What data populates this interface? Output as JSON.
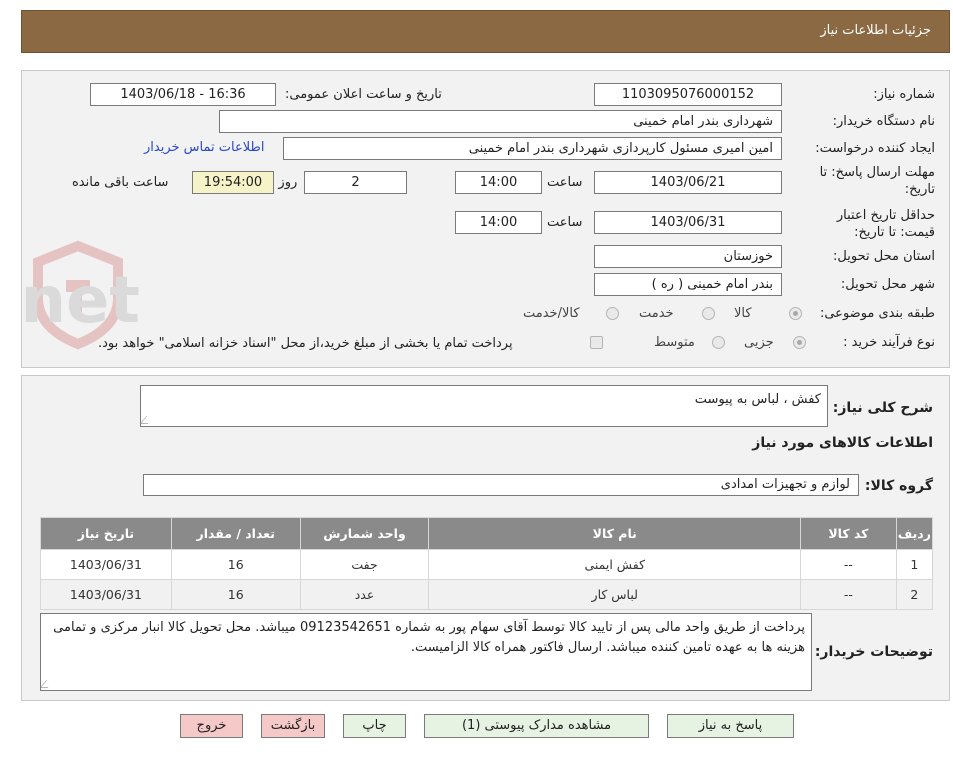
{
  "header": {
    "title": "جزئیات اطلاعات نیاز"
  },
  "form": {
    "need_number_label": "شماره نیاز:",
    "need_number": "1103095076000152",
    "announce_label": "تاریخ و ساعت اعلان عمومی:",
    "announce_value": "1403/06/18 - 16:36",
    "buyer_org_label": "نام دستگاه خریدار:",
    "buyer_org": "شهرداری بندر امام خمینی",
    "creator_label": "ایجاد کننده درخواست:",
    "creator": "امین امیری مسئول کارپردازی شهرداری بندر امام خمینی",
    "contact_link": "اطلاعات تماس خریدار",
    "deadline_label_1": "مهلت ارسال پاسخ: تا",
    "deadline_label_2": "تاریخ:",
    "deadline_date": "1403/06/21",
    "time_label": "ساعت",
    "deadline_time": "14:00",
    "days_value": "2",
    "days_label": "روز و",
    "remaining_time": "19:54:00",
    "remaining_label": "ساعت باقی مانده",
    "validity_label_1": "حداقل تاریخ اعتبار",
    "validity_label_2": "قیمت: تا تاریخ:",
    "validity_date": "1403/06/31",
    "validity_time_label": "ساعت",
    "validity_time": "14:00",
    "province_label": "استان محل تحویل:",
    "province": "خوزستان",
    "city_label": "شهر محل تحویل:",
    "city": "بندر امام خمینی ( ره )",
    "category_label": "طبقه بندی موضوعی:",
    "category_options": [
      "کالا",
      "خدمت",
      "کالا/خدمت"
    ],
    "process_label": "نوع فرآیند خرید :",
    "process_options": [
      "جزیی",
      "متوسط"
    ],
    "payment_note": "پرداخت تمام یا بخشی از مبلغ خرید،از محل \"اسناد خزانه اسلامی\" خواهد بود."
  },
  "details": {
    "summary_label": "شرح کلی نیاز:",
    "summary": "کفش ، لباس به پیوست",
    "goods_info_title": "اطلاعات کالاهای مورد نیاز",
    "group_label": "گروه کالا:",
    "group": "لوازم و تجهیزات امدادی",
    "table": {
      "headers": [
        "ردیف",
        "کد کالا",
        "نام کالا",
        "واحد شمارش",
        "تعداد / مقدار",
        "تاریخ نیاز"
      ],
      "rows": [
        [
          "1",
          "--",
          "کفش ایمنی",
          "جفت",
          "16",
          "1403/06/31"
        ],
        [
          "2",
          "--",
          "لباس کار",
          "عدد",
          "16",
          "1403/06/31"
        ]
      ]
    },
    "buyer_notes_label": "توضیحات خریدار:",
    "buyer_notes": "پرداخت از طریق واحد مالی پس از تایید کالا توسط آقای سهام پور به شماره 09123542651 میباشد. محل تحویل کالا انبار مرکزی و تمامی هزینه ها به عهده تامین کننده میباشد. ارسال فاکتور همراه کالا الزامیست."
  },
  "buttons": {
    "reply": "پاسخ به نیاز",
    "attachments": "مشاهده مدارک پیوستی (1)",
    "print": "چاپ",
    "back": "بازگشت",
    "exit": "خروج"
  },
  "watermark": {
    "text": "AriaTender.net"
  },
  "colors": {
    "header_bg": "#8b6a43",
    "table_header_bg": "#8a8a8a",
    "link": "#2a48c7",
    "remaining_bg": "#f7f3c8",
    "exit_bg": "#f6c9c9",
    "action_bg": "#e6f3e3"
  }
}
